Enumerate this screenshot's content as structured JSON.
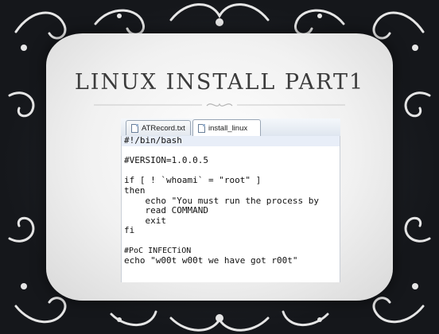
{
  "slide": {
    "title": "LINUX INSTALL PART1"
  },
  "editor": {
    "tabs": [
      {
        "label": "ATRecord.txt",
        "active": false
      },
      {
        "label": "install_linux",
        "active": true
      }
    ],
    "lines": [
      "#!/bin/bash",
      "",
      "#VERSION=1.0.0.5",
      "",
      "if [ ! `whoami` = \"root\" ]",
      "then",
      "    echo \"You must run the process by",
      "    read COMMAND",
      "    exit",
      "fi",
      "",
      "#PoC INFECTiON",
      "echo \"w00t w00t we have got r00t\""
    ]
  },
  "colors": {
    "background": "#17191d",
    "panel": "#f2f2f2",
    "ornament": "#e8e8e8",
    "title_text": "#3b3b3b"
  },
  "icons": [
    "file-icon",
    "scroll-ornament",
    "divider-flourish"
  ]
}
